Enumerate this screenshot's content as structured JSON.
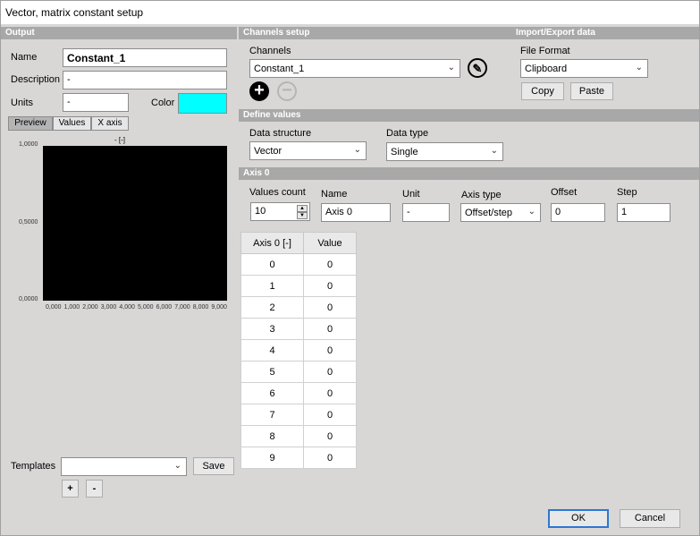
{
  "window": {
    "title": "Vector, matrix constant setup"
  },
  "output": {
    "section_title": "Output",
    "name_label": "Name",
    "name_value": "Constant_1",
    "description_label": "Description",
    "description_value": "-",
    "units_label": "Units",
    "units_value": "-",
    "color_label": "Color",
    "color_value": "#00ffff",
    "tabs": [
      "Preview",
      "Values",
      "X axis"
    ],
    "active_tab": "Preview",
    "templates_label": "Templates",
    "templates_value": "",
    "save_label": "Save",
    "add_label": "+",
    "remove_label": "-"
  },
  "chart_data": {
    "type": "line",
    "title": "- [-]",
    "xlabel": "",
    "ylabel": "",
    "x_ticks": [
      "0,000",
      "1,000",
      "2,000",
      "3,000",
      "4,000",
      "5,000",
      "6,000",
      "7,000",
      "8,000",
      "9,000"
    ],
    "y_ticks": [
      "1,0000",
      "0,5000",
      "0,0000"
    ],
    "xlim": [
      0,
      9
    ],
    "ylim": [
      0,
      1
    ],
    "background": "#000000",
    "series": []
  },
  "channels": {
    "section_title": "Channels setup",
    "channels_label": "Channels",
    "channel_value": "Constant_1",
    "add_icon": "plus-circle-icon",
    "remove_icon": "minus-circle-icon",
    "edit_icon": "pencil-icon"
  },
  "import_export": {
    "section_title": "Import/Export data",
    "format_label": "File Format",
    "format_value": "Clipboard",
    "copy_label": "Copy",
    "paste_label": "Paste"
  },
  "define_values": {
    "section_title": "Define values",
    "structure_label": "Data structure",
    "structure_value": "Vector",
    "type_label": "Data type",
    "type_value": "Single"
  },
  "axis0": {
    "section_title": "Axis 0",
    "count_label": "Values count",
    "count_value": "10",
    "name_label": "Name",
    "name_value": "Axis 0",
    "unit_label": "Unit",
    "unit_value": "-",
    "axis_type_label": "Axis type",
    "axis_type_value": "Offset/step",
    "offset_label": "Offset",
    "offset_value": "0",
    "step_label": "Step",
    "step_value": "1"
  },
  "table": {
    "headers": [
      "Axis 0 [-]",
      "Value"
    ],
    "rows": [
      [
        "0",
        "0"
      ],
      [
        "1",
        "0"
      ],
      [
        "2",
        "0"
      ],
      [
        "3",
        "0"
      ],
      [
        "4",
        "0"
      ],
      [
        "5",
        "0"
      ],
      [
        "6",
        "0"
      ],
      [
        "7",
        "0"
      ],
      [
        "8",
        "0"
      ],
      [
        "9",
        "0"
      ]
    ]
  },
  "footer": {
    "ok_label": "OK",
    "cancel_label": "Cancel"
  }
}
